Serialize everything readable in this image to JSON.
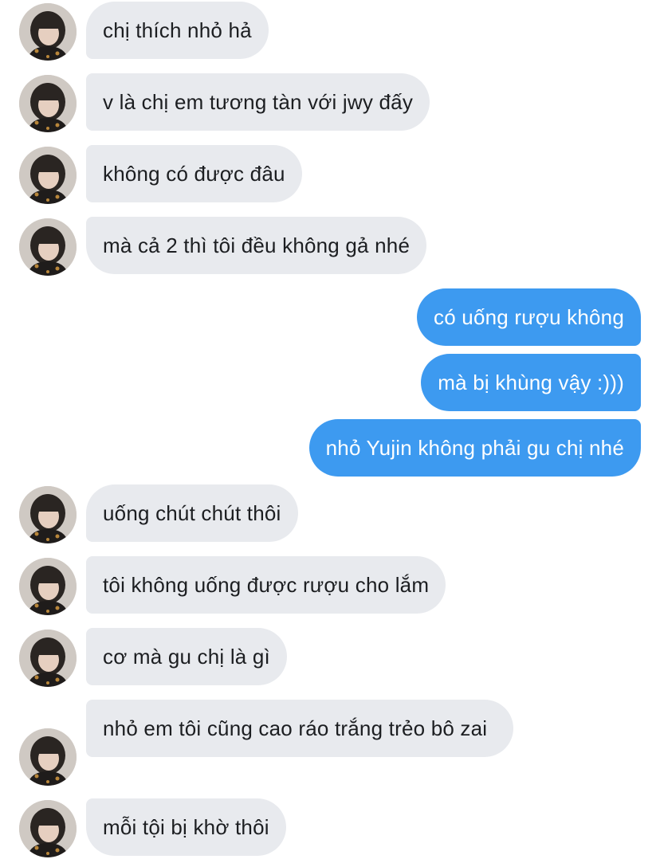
{
  "conversation": {
    "messages": [
      {
        "direction": "in",
        "text": "chị thích nhỏ hả"
      },
      {
        "direction": "in",
        "text": "v là chị em tương tàn với jwy đấy"
      },
      {
        "direction": "in",
        "text": "không có được đâu"
      },
      {
        "direction": "in",
        "text": "mà cả 2 thì tôi đều không gả nhé"
      },
      {
        "direction": "out",
        "text": "có uống rượu không"
      },
      {
        "direction": "out",
        "text": "mà bị khùng vậy :)))"
      },
      {
        "direction": "out",
        "text": "nhỏ Yujin không phải gu chị nhé"
      },
      {
        "direction": "in",
        "text": "uống chút chút thôi"
      },
      {
        "direction": "in",
        "text": "tôi không uống được rượu cho lắm"
      },
      {
        "direction": "in",
        "text": "cơ mà gu chị là gì"
      },
      {
        "direction": "in",
        "text": "nhỏ em tôi cũng cao ráo trắng trẻo bô zai"
      },
      {
        "direction": "in",
        "text": "mỗi tội bị khờ thôi"
      }
    ]
  },
  "theme": {
    "incoming_bubble": "#e8eaee",
    "outgoing_bubble": "#3d9af0",
    "incoming_text": "#1c1e21",
    "outgoing_text": "#ffffff"
  },
  "icons": {
    "avatar": "contact-avatar-photo"
  }
}
